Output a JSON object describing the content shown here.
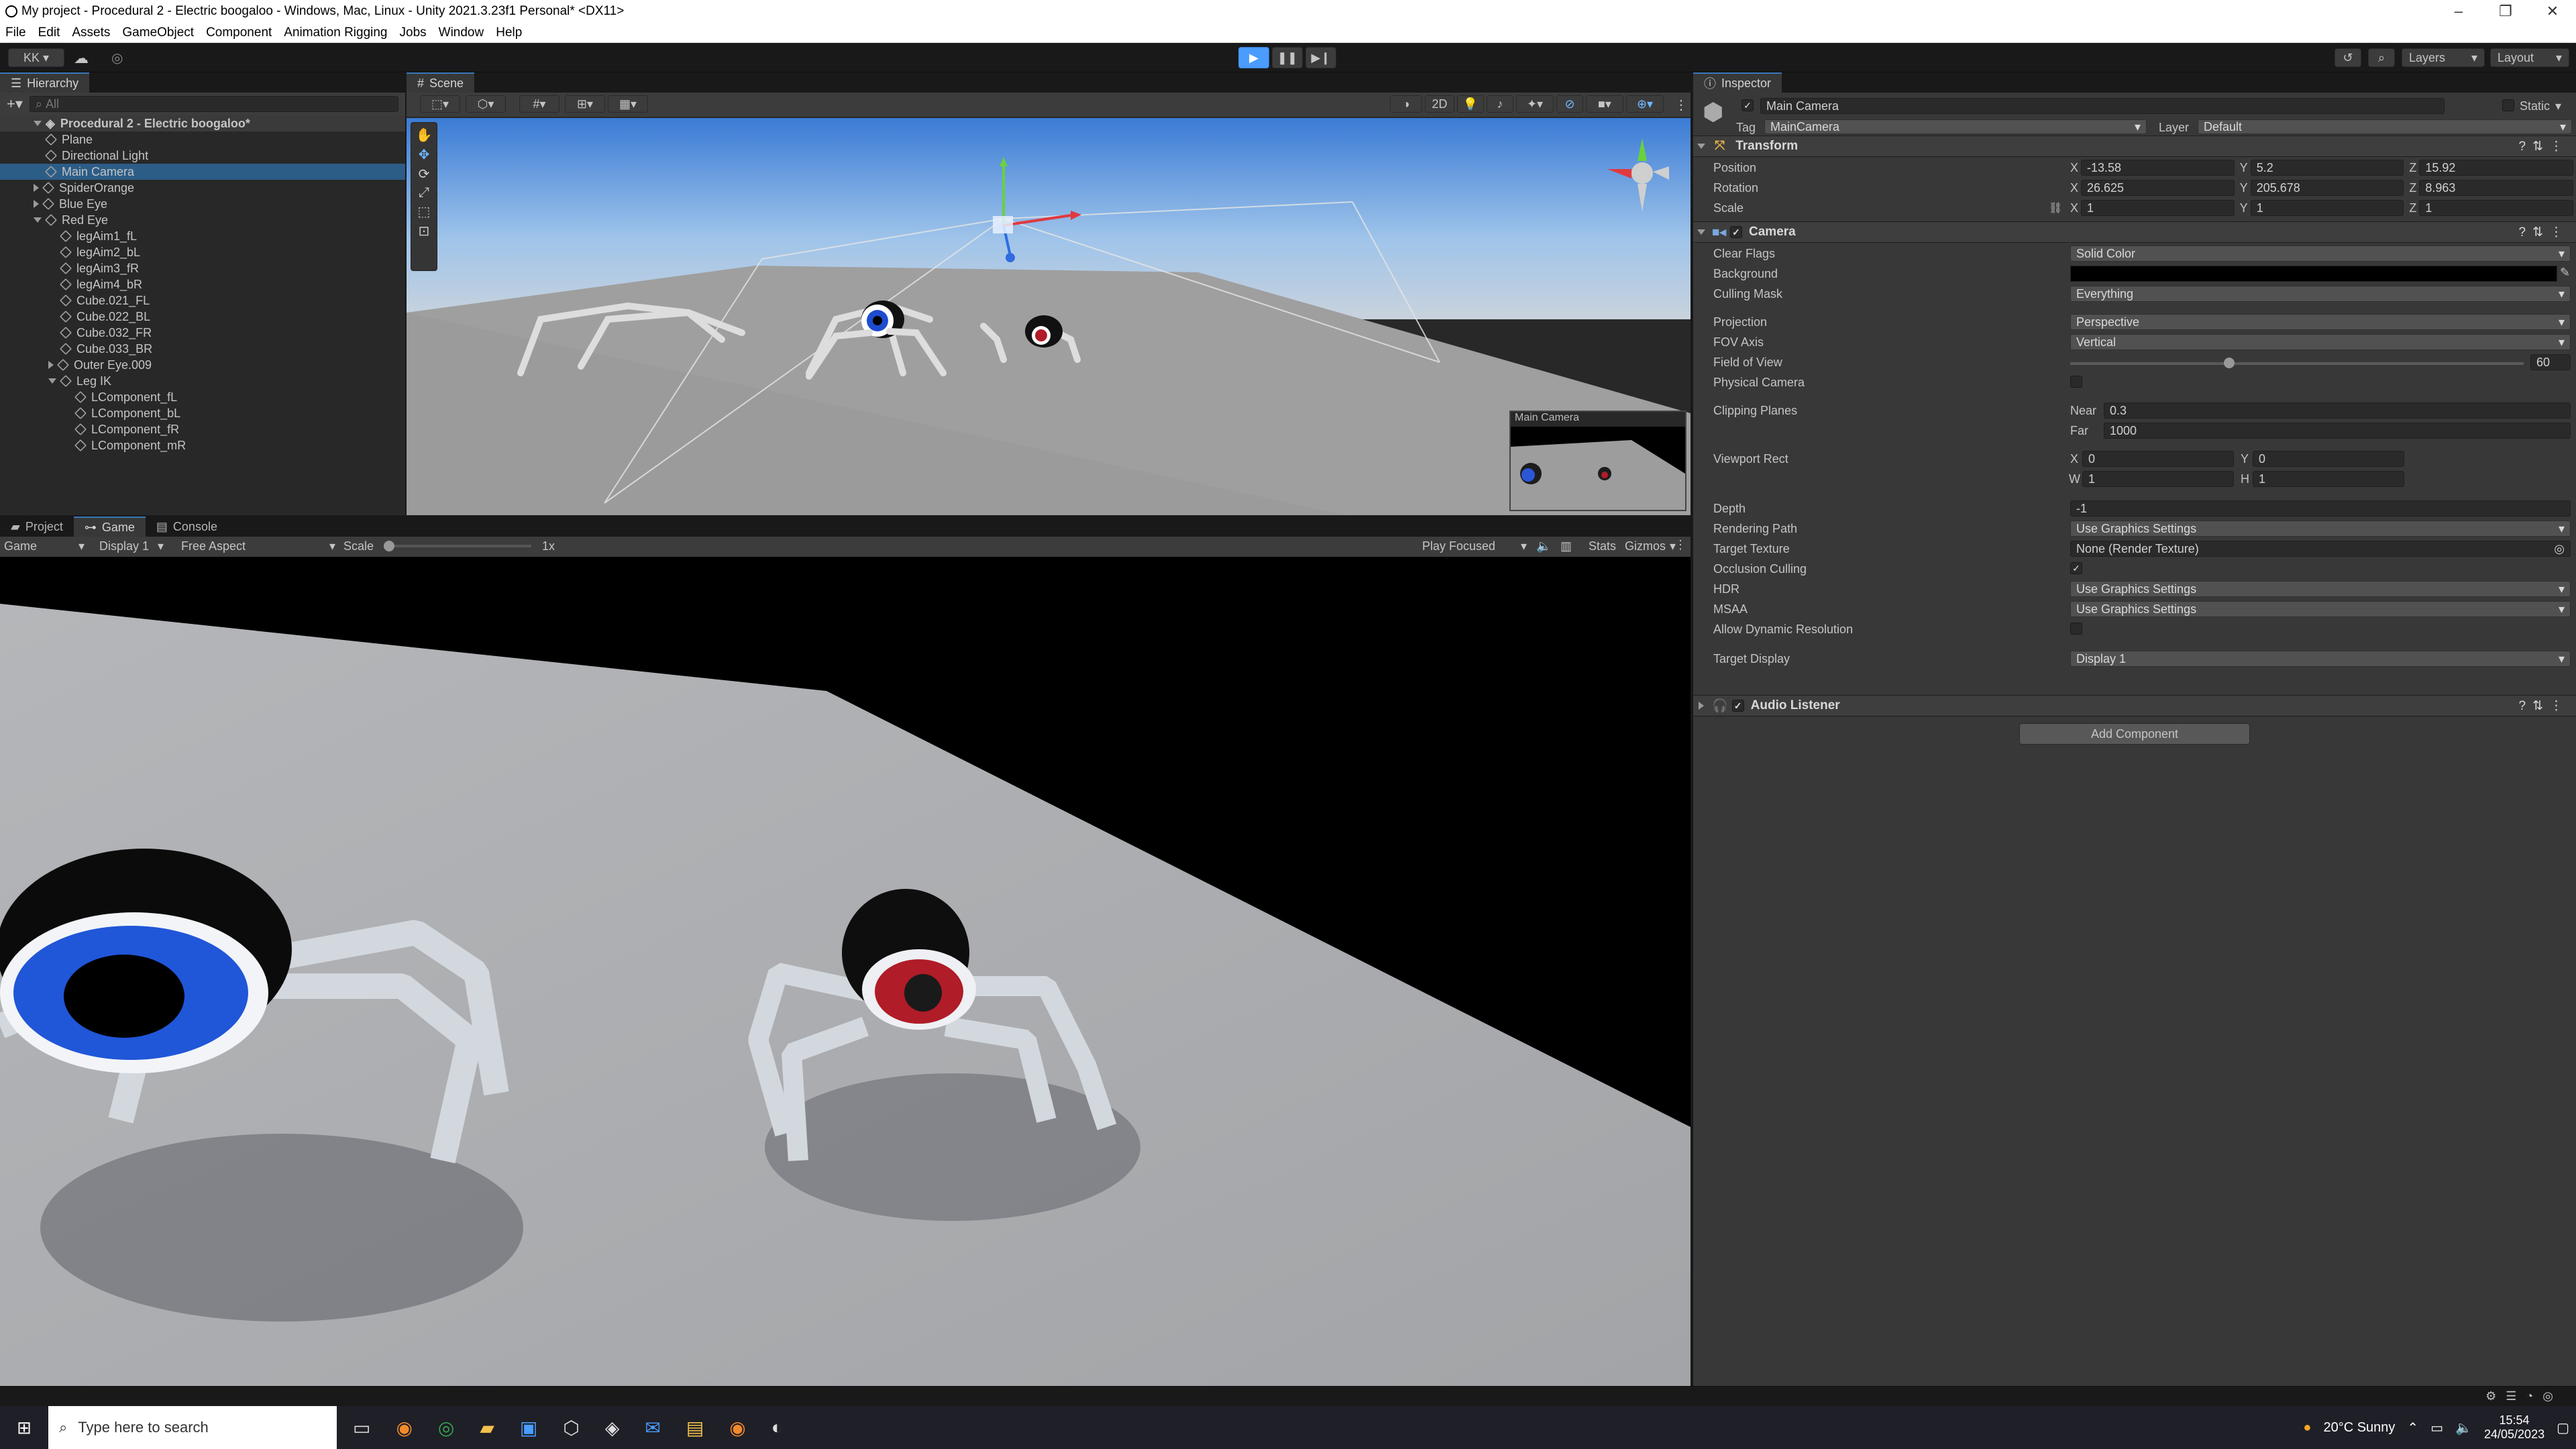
{
  "window": {
    "title": "My project - Procedural 2 - Electric boogaloo - Windows, Mac, Linux - Unity 2021.3.23f1 Personal* <DX11>"
  },
  "menu": [
    "File",
    "Edit",
    "Assets",
    "GameObject",
    "Component",
    "Animation Rigging",
    "Jobs",
    "Window",
    "Help"
  ],
  "toolbar": {
    "account": "KK",
    "layers": "Layers",
    "layout": "Layout"
  },
  "hierarchy": {
    "tab": "Hierarchy",
    "search_placeholder": "All",
    "scene": "Procedural 2 - Electric boogaloo*",
    "items": [
      {
        "label": "Plane",
        "depth": 1,
        "arrow": "none"
      },
      {
        "label": "Directional Light",
        "depth": 1,
        "arrow": "none"
      },
      {
        "label": "Main Camera",
        "depth": 1,
        "arrow": "none",
        "selected": true
      },
      {
        "label": "SpiderOrange",
        "depth": 1,
        "arrow": "right"
      },
      {
        "label": "Blue Eye",
        "depth": 1,
        "arrow": "right"
      },
      {
        "label": "Red Eye",
        "depth": 1,
        "arrow": "down"
      },
      {
        "label": "legAim1_fL",
        "depth": 2,
        "arrow": "none"
      },
      {
        "label": "legAim2_bL",
        "depth": 2,
        "arrow": "none"
      },
      {
        "label": "legAim3_fR",
        "depth": 2,
        "arrow": "none"
      },
      {
        "label": "legAim4_bR",
        "depth": 2,
        "arrow": "none"
      },
      {
        "label": "Cube.021_FL",
        "depth": 2,
        "arrow": "none"
      },
      {
        "label": "Cube.022_BL",
        "depth": 2,
        "arrow": "none"
      },
      {
        "label": "Cube.032_FR",
        "depth": 2,
        "arrow": "none"
      },
      {
        "label": "Cube.033_BR",
        "depth": 2,
        "arrow": "none"
      },
      {
        "label": "Outer Eye.009",
        "depth": 2,
        "arrow": "right"
      },
      {
        "label": "Leg IK",
        "depth": 2,
        "arrow": "down"
      },
      {
        "label": "LComponent_fL",
        "depth": 3,
        "arrow": "none"
      },
      {
        "label": "LComponent_bL",
        "depth": 3,
        "arrow": "none"
      },
      {
        "label": "LComponent_fR",
        "depth": 3,
        "arrow": "none"
      },
      {
        "label": "LComponent_mR",
        "depth": 3,
        "arrow": "none"
      }
    ]
  },
  "scene": {
    "tab": "Scene",
    "mode_2d": "2D",
    "preview_title": "Main Camera"
  },
  "bottom": {
    "tabs": [
      "Project",
      "Game",
      "Console"
    ],
    "game_label": "Game",
    "display": "Display 1",
    "aspect": "Free Aspect",
    "scale_label": "Scale",
    "scale_value": "1x",
    "play_focused": "Play Focused",
    "stats": "Stats",
    "gizmos": "Gizmos"
  },
  "inspector": {
    "tab": "Inspector",
    "object_name": "Main Camera",
    "static_label": "Static",
    "tag_label": "Tag",
    "tag": "MainCamera",
    "layer_label": "Layer",
    "layer": "Default",
    "transform": {
      "title": "Transform",
      "position_label": "Position",
      "pos": {
        "x": "-13.58",
        "y": "5.2",
        "z": "15.92"
      },
      "rotation_label": "Rotation",
      "rot": {
        "x": "26.625",
        "y": "205.678",
        "z": "8.963"
      },
      "scale_label": "Scale",
      "scale": {
        "x": "1",
        "y": "1",
        "z": "1"
      }
    },
    "camera": {
      "title": "Camera",
      "clear_flags_label": "Clear Flags",
      "clear_flags": "Solid Color",
      "background_label": "Background",
      "culling_mask_label": "Culling Mask",
      "culling_mask": "Everything",
      "projection_label": "Projection",
      "projection": "Perspective",
      "fov_axis_label": "FOV Axis",
      "fov_axis": "Vertical",
      "fov_label": "Field of View",
      "fov": "60",
      "fov_level": 0.35,
      "physical_label": "Physical Camera",
      "clipping_label": "Clipping Planes",
      "near_label": "Near",
      "near": "0.3",
      "far_label": "Far",
      "far": "1000",
      "viewport_label": "Viewport Rect",
      "vx": "0",
      "vy": "0",
      "vw": "1",
      "vh": "1",
      "depth_label": "Depth",
      "depth": "-1",
      "rendering_path_label": "Rendering Path",
      "rendering_path": "Use Graphics Settings",
      "target_texture_label": "Target Texture",
      "target_texture": "None (Render Texture)",
      "occlusion_label": "Occlusion Culling",
      "hdr_label": "HDR",
      "hdr": "Use Graphics Settings",
      "msaa_label": "MSAA",
      "msaa": "Use Graphics Settings",
      "dynamic_label": "Allow Dynamic Resolution",
      "target_display_label": "Target Display",
      "target_display": "Display 1"
    },
    "audio_listener": "Audio Listener",
    "add_component": "Add Component"
  },
  "taskbar": {
    "search_placeholder": "Type here to search",
    "weather": "20°C  Sunny",
    "time": "15:54",
    "date": "24/05/2023"
  },
  "colors": {
    "accent": "#3a79bb",
    "selected_row": "#2c5d87",
    "play_blue": "#4a9cff"
  }
}
